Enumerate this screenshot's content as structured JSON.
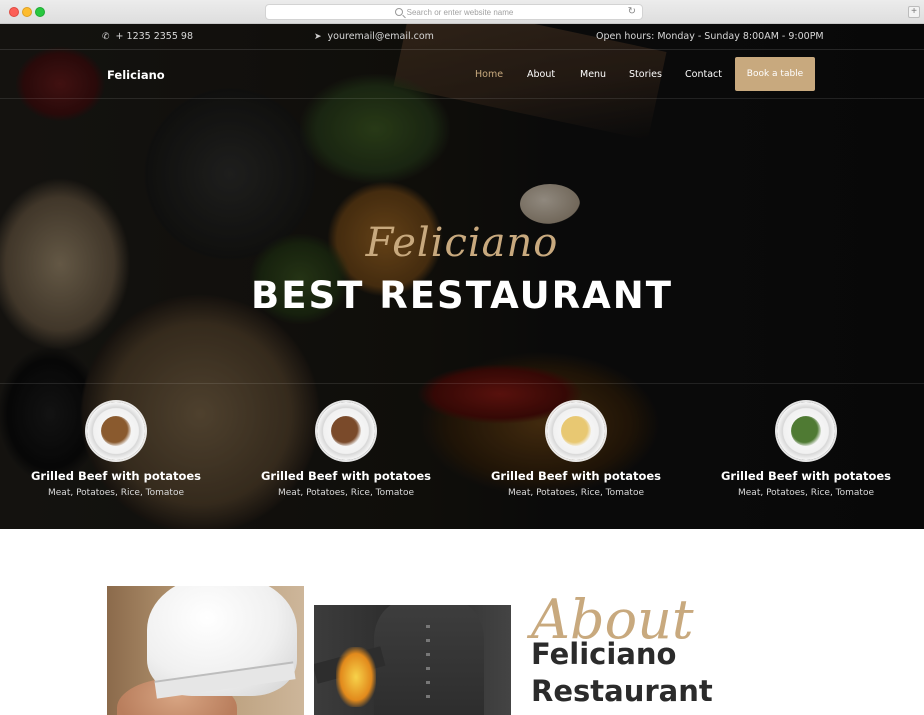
{
  "browser": {
    "address_placeholder": "Search or enter website name",
    "reload_glyph": "↻",
    "new_tab_glyph": "+"
  },
  "topbar": {
    "phone": "+ 1235 2355 98",
    "email": "youremail@email.com",
    "hours": "Open hours: Monday - Sunday 8:00AM - 9:00PM"
  },
  "nav": {
    "brand": "Feliciano",
    "links": [
      "Home",
      "About",
      "Menu",
      "Stories",
      "Contact"
    ],
    "active": "Home",
    "cta": "Book a table"
  },
  "hero": {
    "script_title": "Feliciano",
    "title": "BEST RESTAURANT"
  },
  "dishes": [
    {
      "name": "Grilled Beef with potatoes",
      "ingredients": "Meat, Potatoes, Rice, Tomatoe",
      "food_color": "#8a5a2e"
    },
    {
      "name": "Grilled Beef with potatoes",
      "ingredients": "Meat, Potatoes, Rice, Tomatoe",
      "food_color": "#7a4a2a"
    },
    {
      "name": "Grilled Beef with potatoes",
      "ingredients": "Meat, Potatoes, Rice, Tomatoe",
      "food_color": "#e8c872"
    },
    {
      "name": "Grilled Beef with potatoes",
      "ingredients": "Meat, Potatoes, Rice, Tomatoe",
      "food_color": "#4f7a33"
    }
  ],
  "about": {
    "script": "About",
    "heading_line1": "Feliciano",
    "heading_line2": "Restaurant"
  },
  "colors": {
    "accent": "#c8a97e",
    "dark_text": "#2b2b2b"
  },
  "icons": {
    "phone": "phone-icon",
    "email": "paper-plane-icon"
  }
}
